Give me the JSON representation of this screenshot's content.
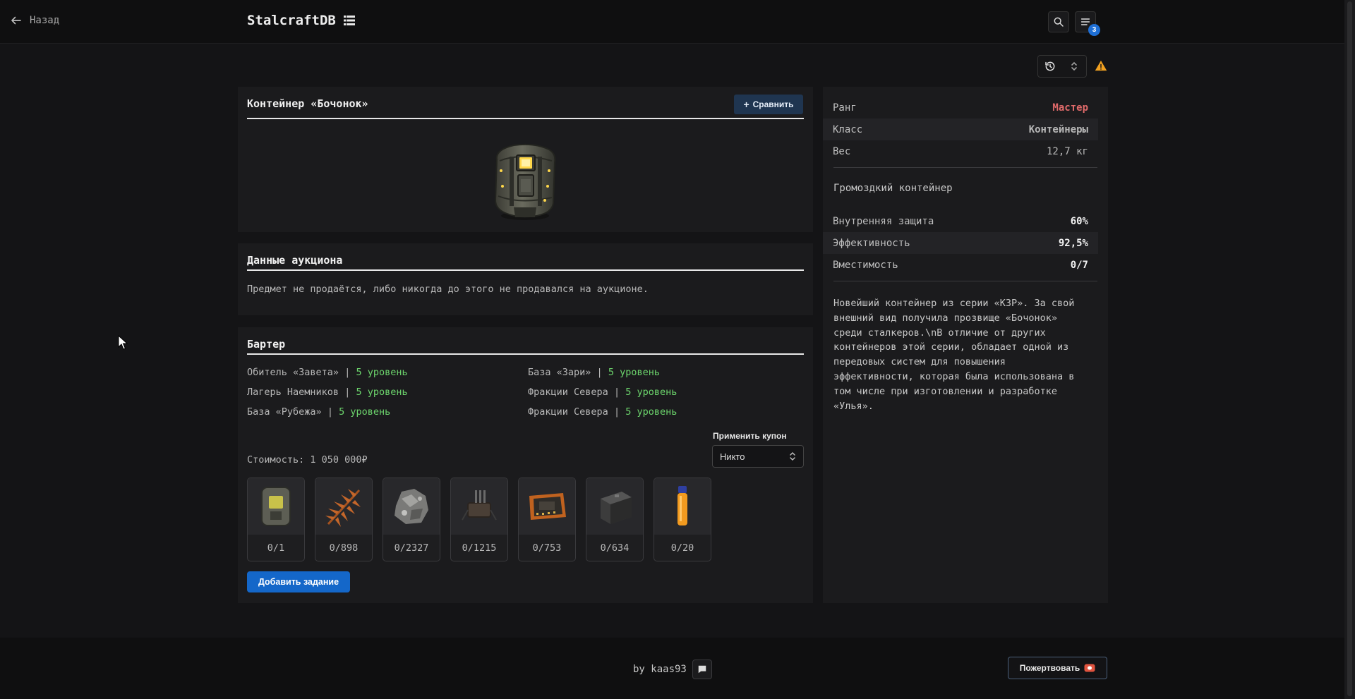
{
  "header": {
    "back_label": "Назад",
    "logo": "StalcraftDB",
    "notifications_count": "3"
  },
  "item": {
    "title": "Контейнер «Бочонок»",
    "compare_label": "Сравнить"
  },
  "auction": {
    "title": "Данные аукциона",
    "message": "Предмет не продаётся, либо никогда до этого не продавался на аукционе."
  },
  "barter": {
    "title": "Бартер",
    "separator": "|",
    "locations": [
      {
        "name": "Обитель «Завета»",
        "level": "5 уровень"
      },
      {
        "name": "База «Зари»",
        "level": "5 уровень"
      },
      {
        "name": "Лагерь Наемников",
        "level": "5 уровень"
      },
      {
        "name": "Фракции Севера",
        "level": "5 уровень"
      },
      {
        "name": "База «Рубежа»",
        "level": "5 уровень"
      },
      {
        "name": "Фракции Севера",
        "level": "5 уровень"
      }
    ],
    "cost": "Стоимость: 1 050 000₽",
    "coupon_label": "Применить купон",
    "coupon_value": "Никто",
    "ingredients": [
      {
        "icon": "container-icon",
        "count": "0/1"
      },
      {
        "icon": "fern-icon",
        "count": "0/898"
      },
      {
        "icon": "ore-icon",
        "count": "0/2327"
      },
      {
        "icon": "device-icon",
        "count": "0/1215"
      },
      {
        "icon": "circuit-board-icon",
        "count": "0/753"
      },
      {
        "icon": "battery-icon",
        "count": "0/634"
      },
      {
        "icon": "vial-icon",
        "count": "0/20"
      }
    ],
    "add_task_label": "Добавить задание"
  },
  "stats": {
    "rank_key": "Ранг",
    "rank_value": "Мастер",
    "class_key": "Класс",
    "class_value": "Контейнеры",
    "weight_key": "Вес",
    "weight_value": "12,7 кг",
    "type_text": "Громоздкий контейнер",
    "protection_key": "Внутренняя защита",
    "protection_value": "60%",
    "efficiency_key": "Эффективность",
    "efficiency_value": "92,5%",
    "capacity_key": "Вместимость",
    "capacity_value": "0/7",
    "description": "Новейший контейнер из серии «КЗР». За свой внешний вид получила прозвище «Бочонок» среди сталкеров.\\nВ отличие от других контейнеров этой серии, обладает одной из передовых систем для повышения эффективности, которая была использована в том числе при изготовлении и разработке «Улья»."
  },
  "footer": {
    "by_label": "by kaas93",
    "donate_label": "Пожертвовать"
  },
  "colors": {
    "rank": "#e06a6a",
    "level": "#6dd66d",
    "accent": "#1467c9"
  }
}
